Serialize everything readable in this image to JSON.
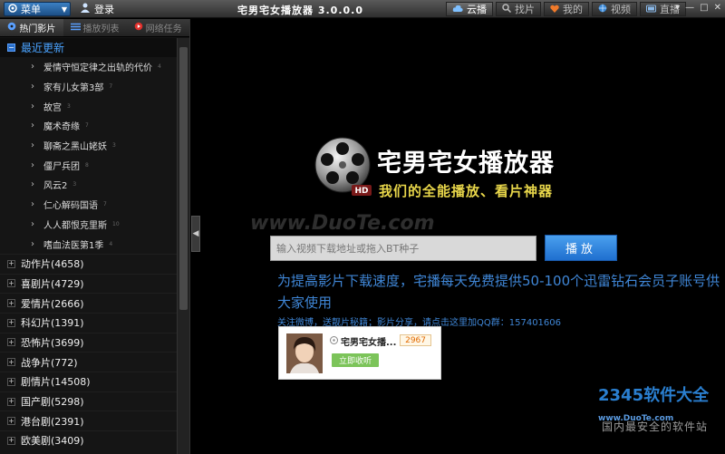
{
  "titlebar": {
    "menu_label": "菜单",
    "login_label": "登录",
    "app_title": "宅男宅女播放器 3.0.0.0",
    "tabs": [
      {
        "label": "云播",
        "icon": "cloud-icon",
        "active": true
      },
      {
        "label": "找片",
        "icon": "search-icon",
        "active": false
      },
      {
        "label": "我的",
        "icon": "heart-icon",
        "active": false
      },
      {
        "label": "视频",
        "icon": "globe-icon",
        "active": false
      },
      {
        "label": "直播",
        "icon": "tv-icon",
        "active": false
      }
    ]
  },
  "sidebar": {
    "tabs": [
      {
        "label": "热门影片",
        "icon": "film-icon",
        "active": true
      },
      {
        "label": "播放列表",
        "icon": "list-icon",
        "active": false
      },
      {
        "label": "网络任务",
        "icon": "record-icon",
        "active": false
      }
    ],
    "recent_label": "最近更新",
    "recent_items": [
      {
        "title": "爱情守恒定律之出轨的代价",
        "count": "4"
      },
      {
        "title": "家有儿女第3部",
        "count": "7"
      },
      {
        "title": "故宫",
        "count": "3"
      },
      {
        "title": "魔术奇缘",
        "count": "7"
      },
      {
        "title": "聊斋之黑山姥妖",
        "count": "3"
      },
      {
        "title": "僵尸兵团",
        "count": "8"
      },
      {
        "title": "风云2",
        "count": "3"
      },
      {
        "title": "仁心解码国语",
        "count": "7"
      },
      {
        "title": "人人都恨克里斯",
        "count": "10"
      },
      {
        "title": "嗜血法医第1季",
        "count": "4"
      }
    ],
    "categories": [
      {
        "label": "动作片(4658)"
      },
      {
        "label": "喜剧片(4729)"
      },
      {
        "label": "爱情片(2666)"
      },
      {
        "label": "科幻片(1391)"
      },
      {
        "label": "恐怖片(3699)"
      },
      {
        "label": "战争片(772)"
      },
      {
        "label": "剧情片(14508)"
      },
      {
        "label": "国产剧(5298)"
      },
      {
        "label": "港台剧(2391)"
      },
      {
        "label": "欧美剧(3409)"
      }
    ]
  },
  "main": {
    "logo_title": "宅男宅女播放器",
    "logo_slogan": "我们的全能播放、看片神器",
    "logo_badge": "HD",
    "watermark": "www.DuoTe.com",
    "search": {
      "placeholder": "输入视频下载地址或拖入BT种子",
      "value": ""
    },
    "play_label": "播放",
    "promo_text": "为提高影片下载速度，宅播每天免费提供50-100个迅雷钻石会员子账号供大家使用",
    "qq_line": "关注微博，送靓片秘籍；影片分享，请点击这里加QQ群：157401606",
    "card": {
      "name": "宅男宅女播...",
      "count": "2967",
      "follow_label": "立即收听"
    },
    "brand": {
      "logo_text": "2345软件大全",
      "logo_en": "www.DuoTe.com",
      "subtitle": "国内最安全的软件站"
    }
  },
  "colors": {
    "accent": "#3f86d6",
    "title_bg": "#3a3a3a",
    "slogan": "#e8d64a",
    "play_button": "#2a7fd6"
  }
}
